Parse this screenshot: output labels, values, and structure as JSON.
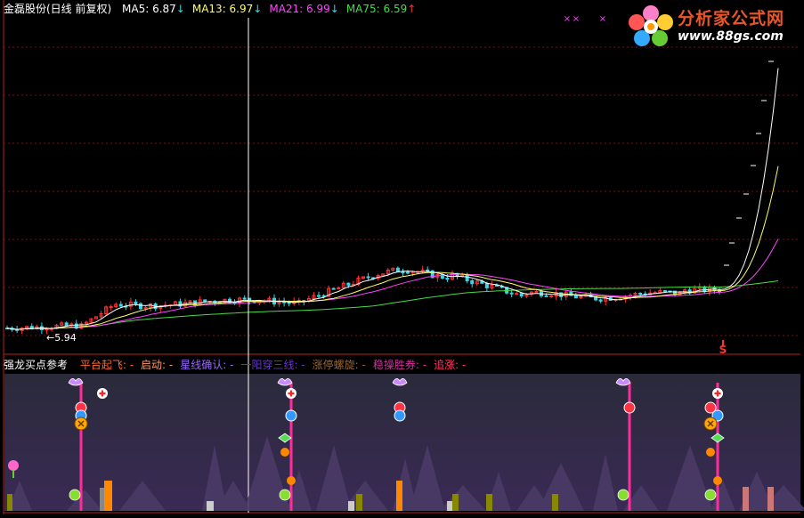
{
  "header": {
    "stock_title": "金磊股份(日线 前复权)",
    "ma": [
      {
        "label": "MA5: 6.87",
        "arrow": "↓",
        "color": "#ffffff",
        "arrow_color": "#3ad6e6"
      },
      {
        "label": "MA13: 6.97",
        "arrow": "↓",
        "color": "#ffff66",
        "arrow_color": "#3ad6e6"
      },
      {
        "label": "MA21: 6.99",
        "arrow": "↓",
        "color": "#ff44ff",
        "arrow_color": "#3ad6e6"
      },
      {
        "label": "MA75: 6.59",
        "arrow": "↑",
        "color": "#44dd44",
        "arrow_color": "#ff3333"
      }
    ]
  },
  "indicator_header": {
    "title": "强龙买点参考",
    "items": [
      {
        "label": "平台起飞: -",
        "color": "#ff6633"
      },
      {
        "label": "启动: -",
        "color": "#ff9966"
      },
      {
        "label": "星线确认: -",
        "color": "#9966ff"
      },
      {
        "label": "一阳穿三线: -",
        "color": "#6633cc"
      },
      {
        "label": "涨停螺旋: -",
        "color": "#996633"
      },
      {
        "label": "稳操胜券: -",
        "color": "#cc3399"
      },
      {
        "label": "追涨: -",
        "color": "#ff3366"
      }
    ]
  },
  "logo": {
    "brand": "分析家公式网",
    "url": "www.88gs.com"
  },
  "chart_data": {
    "type": "candlestick",
    "low_label": "5.94",
    "signal_label": "S",
    "price_range": [
      5.6,
      13.6
    ],
    "n_bars": 145,
    "colors": {
      "up": "#ff3333",
      "down": "#3ad6e6",
      "ma5": "#ffffff",
      "ma13": "#ffff66",
      "ma21": "#ff44ff",
      "ma75": "#44dd44",
      "indicator_line": "#ff2d9a"
    }
  }
}
